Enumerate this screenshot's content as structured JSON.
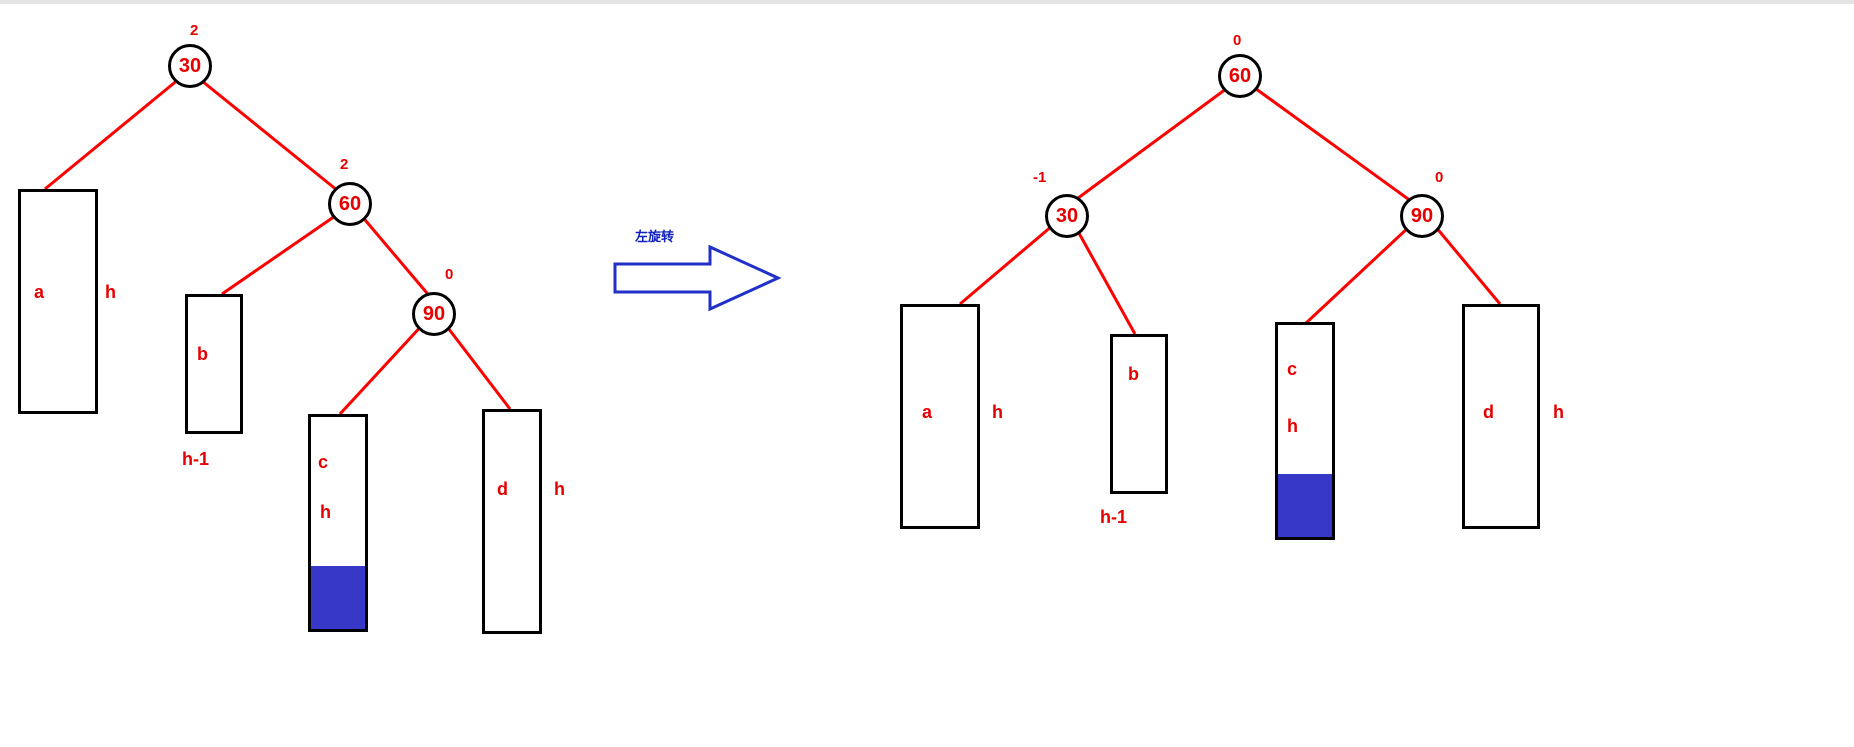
{
  "arrow_label": "左旋转",
  "left": {
    "nodes": {
      "n30": {
        "value": "30",
        "balance": "2"
      },
      "n60": {
        "value": "60",
        "balance": "2"
      },
      "n90": {
        "value": "90",
        "balance": "0"
      }
    },
    "subtrees": {
      "a": {
        "label": "a",
        "height_label": "h"
      },
      "b": {
        "label": "b",
        "height_label": "h-1"
      },
      "c": {
        "label": "c",
        "height_label": "h"
      },
      "d": {
        "label": "d",
        "height_label": "h"
      }
    }
  },
  "right": {
    "nodes": {
      "n60": {
        "value": "60",
        "balance": "0"
      },
      "n30": {
        "value": "30",
        "balance": "-1"
      },
      "n90": {
        "value": "90",
        "balance": "0"
      }
    },
    "subtrees": {
      "a": {
        "label": "a",
        "height_label": "h"
      },
      "b": {
        "label": "b",
        "height_label": "h-1"
      },
      "c": {
        "label": "c",
        "height_label": "h"
      },
      "d": {
        "label": "d",
        "height_label": "h"
      }
    }
  }
}
